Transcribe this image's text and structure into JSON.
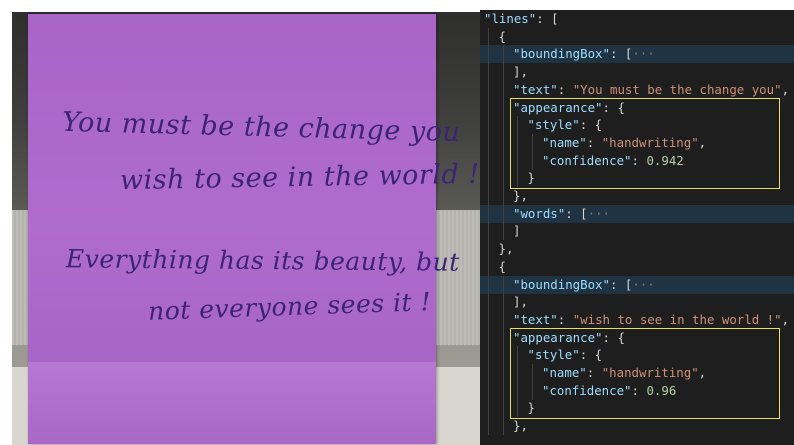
{
  "photo": {
    "note_lines": [
      "You must be the change you",
      "wish to see in the world !",
      "Everything has its beauty, but",
      "not everyone sees it !"
    ]
  },
  "editor": {
    "rows": [
      {
        "ind": 0,
        "k": "\"lines\"",
        "p": ": ["
      },
      {
        "ind": 1,
        "p": "{"
      },
      {
        "ind": 2,
        "k": "\"boundingBox\"",
        "p": ": [",
        "f": "···",
        "hl": true
      },
      {
        "ind": 2,
        "p": "],"
      },
      {
        "ind": 2,
        "k": "\"text\"",
        "p": ": ",
        "s": "\"You must be the change you\"",
        "t": ","
      },
      {
        "ind": 2,
        "k": "\"appearance\"",
        "p": ": {"
      },
      {
        "ind": 3,
        "k": "\"style\"",
        "p": ": {"
      },
      {
        "ind": 4,
        "k": "\"name\"",
        "p": ": ",
        "s": "\"handwriting\"",
        "t": ","
      },
      {
        "ind": 4,
        "k": "\"confidence\"",
        "p": ": ",
        "n": "0.942"
      },
      {
        "ind": 3,
        "p": "}"
      },
      {
        "ind": 2,
        "p": "},"
      },
      {
        "ind": 2,
        "k": "\"words\"",
        "p": ": [",
        "f": "···",
        "hl": true
      },
      {
        "ind": 2,
        "p": "]"
      },
      {
        "ind": 1,
        "p": "},"
      },
      {
        "ind": 1,
        "p": "{"
      },
      {
        "ind": 2,
        "k": "\"boundingBox\"",
        "p": ": [",
        "f": "···",
        "hl": true
      },
      {
        "ind": 2,
        "p": "],"
      },
      {
        "ind": 2,
        "k": "\"text\"",
        "p": ": ",
        "s": "\"wish to see in the world !\"",
        "t": ","
      },
      {
        "ind": 2,
        "k": "\"appearance\"",
        "p": ": {"
      },
      {
        "ind": 3,
        "k": "\"style\"",
        "p": ": {"
      },
      {
        "ind": 4,
        "k": "\"name\"",
        "p": ": ",
        "s": "\"handwriting\"",
        "t": ","
      },
      {
        "ind": 4,
        "k": "\"confidence\"",
        "p": ": ",
        "n": "0.96"
      },
      {
        "ind": 3,
        "p": "}"
      },
      {
        "ind": 2,
        "p": "},"
      }
    ]
  },
  "colors": {
    "note": "#b06bcf",
    "ink": "#3b2478",
    "highlight_box": "#e6e15a",
    "editor_bg": "#1e1e1e",
    "json_key": "#9cdcfe",
    "json_string": "#ce9178",
    "json_number": "#b5cea8"
  }
}
